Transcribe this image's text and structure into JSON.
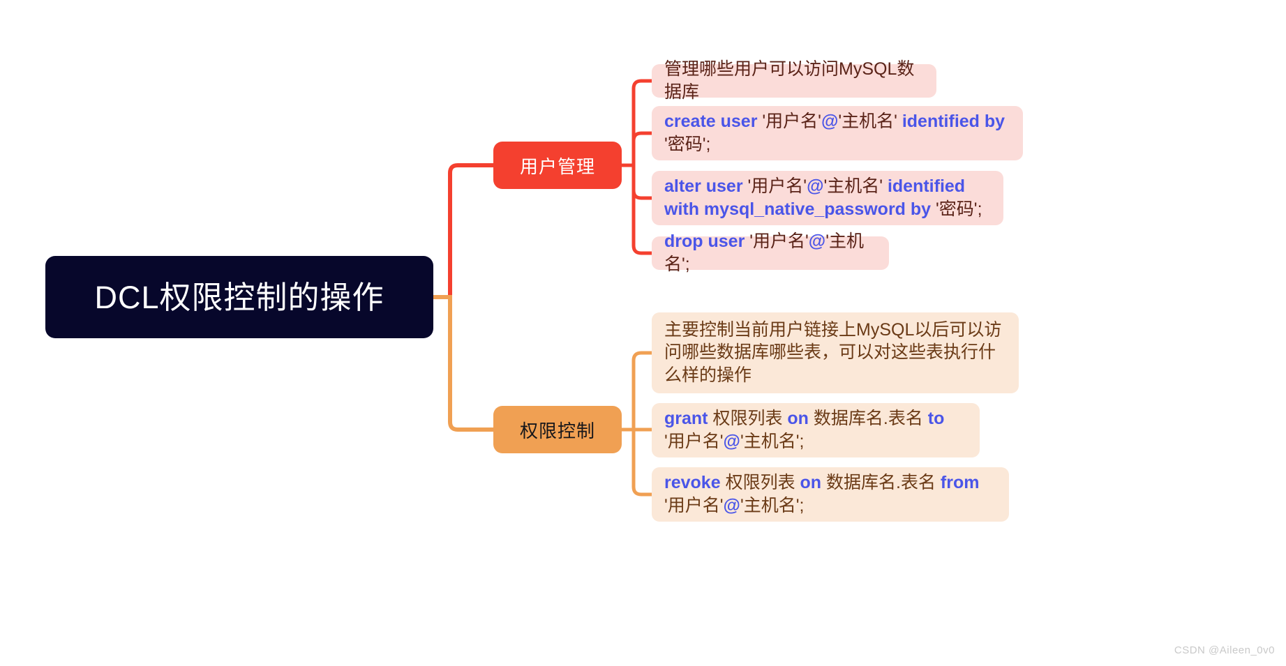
{
  "diagram": {
    "type": "mindmap",
    "root": {
      "label": "DCL权限控制的操作",
      "color": "#07072b",
      "text_color": "#ffffff"
    },
    "branches": [
      {
        "id": "user-management",
        "label": "用户管理",
        "color": "#f4402f",
        "text_color": "#ffffff",
        "card_color": "#fbdcd9",
        "leaves": [
          {
            "id": "u1",
            "parts": [
              {
                "t": "管理哪些用户可以访问MySQL数据库",
                "style": "plain"
              }
            ]
          },
          {
            "id": "u2",
            "parts": [
              {
                "t": "create user",
                "style": "kw"
              },
              {
                "t": " '用户名'",
                "style": "plain"
              },
              {
                "t": "@",
                "style": "at"
              },
              {
                "t": "'主机名'  ",
                "style": "plain"
              },
              {
                "t": "identified by",
                "style": "kw"
              },
              {
                "t": " '密码';",
                "style": "plain"
              }
            ]
          },
          {
            "id": "u3",
            "parts": [
              {
                "t": "alter user",
                "style": "kw"
              },
              {
                "t": " '用户名'",
                "style": "plain"
              },
              {
                "t": "@",
                "style": "at"
              },
              {
                "t": "'主机名'  ",
                "style": "plain"
              },
              {
                "t": "identified with mysql_native_password by",
                "style": "kw"
              },
              {
                "t": " '密码';",
                "style": "plain"
              }
            ]
          },
          {
            "id": "u4",
            "parts": [
              {
                "t": "drop user",
                "style": "kw"
              },
              {
                "t": " '用户名'",
                "style": "plain"
              },
              {
                "t": "@",
                "style": "at"
              },
              {
                "t": "'主机名';",
                "style": "plain"
              }
            ]
          }
        ]
      },
      {
        "id": "privilege-control",
        "label": "权限控制",
        "color": "#f0a053",
        "text_color": "#16161a",
        "card_color": "#fbe8d8",
        "leaves": [
          {
            "id": "p1",
            "parts": [
              {
                "t": "主要控制当前用户链接上MySQL以后可以访问哪些数据库哪些表，可以对这些表执行什么样的操作",
                "style": "plain"
              }
            ]
          },
          {
            "id": "p2",
            "parts": [
              {
                "t": "grant",
                "style": "kw"
              },
              {
                "t": " 权限列表 ",
                "style": "plain"
              },
              {
                "t": "on",
                "style": "kw"
              },
              {
                "t": " 数据库名.表名 ",
                "style": "plain"
              },
              {
                "t": "to",
                "style": "kw"
              },
              {
                "t": "  '用户名'",
                "style": "plain"
              },
              {
                "t": "@",
                "style": "at"
              },
              {
                "t": "'主机名';",
                "style": "plain"
              }
            ]
          },
          {
            "id": "p3",
            "parts": [
              {
                "t": "revoke",
                "style": "kw"
              },
              {
                "t": " 权限列表 ",
                "style": "plain"
              },
              {
                "t": "on",
                "style": "kw"
              },
              {
                "t": " 数据库名.表名 ",
                "style": "plain"
              },
              {
                "t": "from",
                "style": "kw"
              },
              {
                "t": "  '用户名'",
                "style": "plain"
              },
              {
                "t": "@",
                "style": "at"
              },
              {
                "t": "'主机名';",
                "style": "plain"
              }
            ]
          }
        ]
      }
    ],
    "keyword_color": "#4a55e8",
    "connector_colors": {
      "user-management": "#f4402f",
      "privilege-control": "#f0a053"
    }
  },
  "watermark": {
    "text": "CSDN @Aileen_0v0"
  }
}
